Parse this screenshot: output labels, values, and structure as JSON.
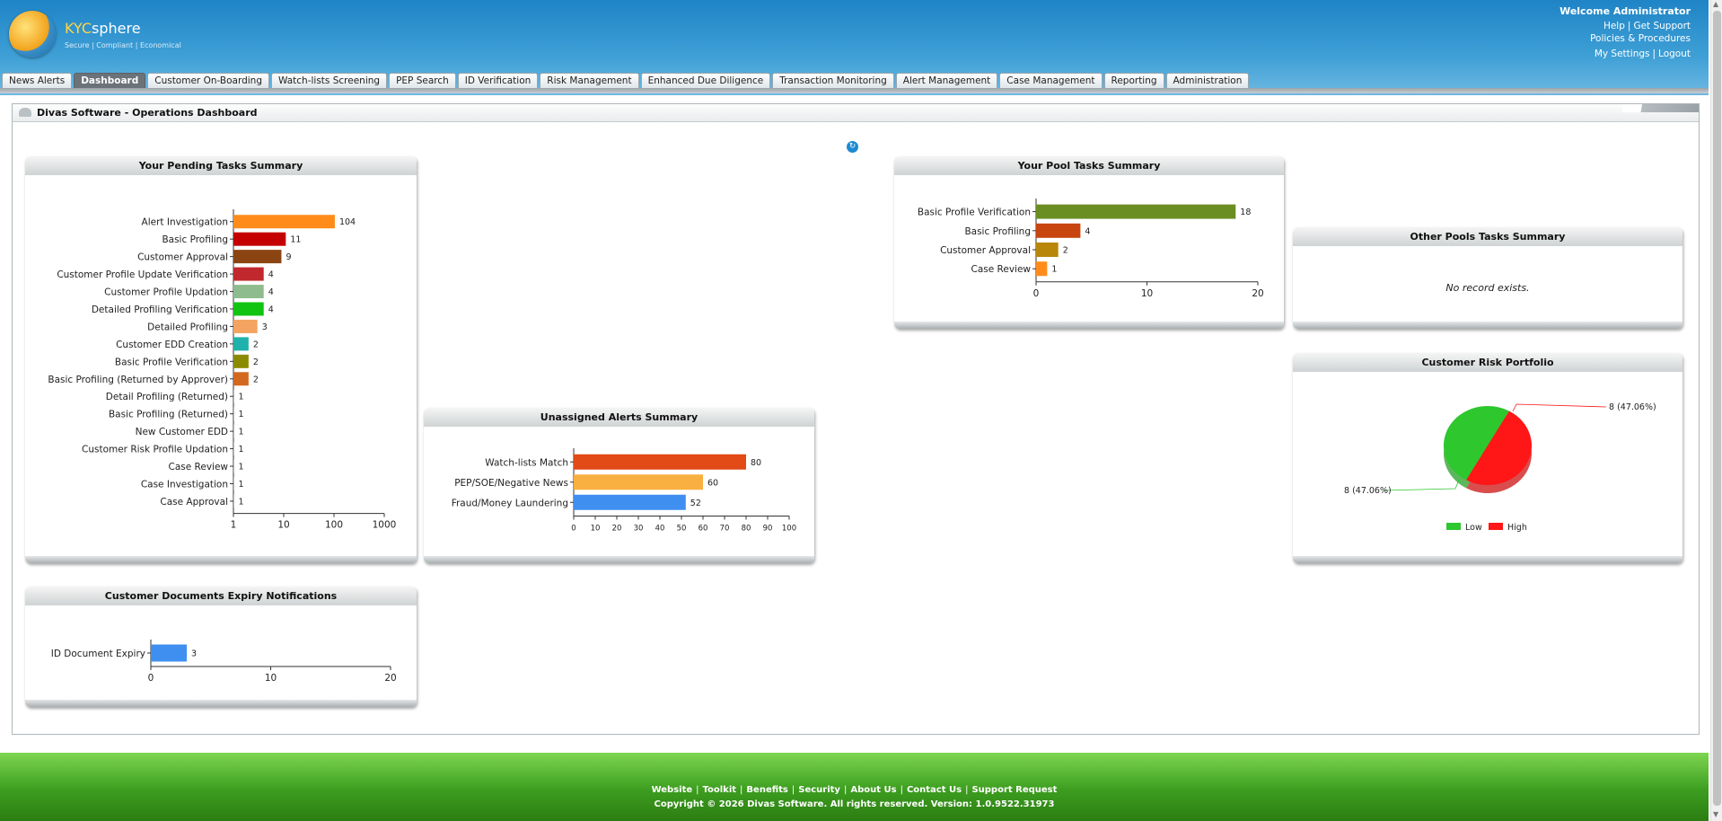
{
  "header": {
    "brand_kyc": "KYC",
    "brand_sphere": "sphere",
    "tagline": "Secure | Compliant | Economical",
    "welcome": "Welcome Administrator",
    "links_row1": [
      "Help",
      "Get Support"
    ],
    "links_row2": [
      "Policies & Procedures"
    ],
    "links_row3": [
      "My Settings",
      "Logout"
    ]
  },
  "tabs": [
    {
      "label": "News Alerts",
      "active": false
    },
    {
      "label": "Dashboard",
      "active": true
    },
    {
      "label": "Customer On-Boarding",
      "active": false
    },
    {
      "label": "Watch-lists Screening",
      "active": false
    },
    {
      "label": "PEP Search",
      "active": false
    },
    {
      "label": "ID Verification",
      "active": false
    },
    {
      "label": "Risk Management",
      "active": false
    },
    {
      "label": "Enhanced Due Diligence",
      "active": false
    },
    {
      "label": "Transaction Monitoring",
      "active": false
    },
    {
      "label": "Alert Management",
      "active": false
    },
    {
      "label": "Case Management",
      "active": false
    },
    {
      "label": "Reporting",
      "active": false
    },
    {
      "label": "Administration",
      "active": false
    }
  ],
  "panel_title": "Divas Software - Operations Dashboard",
  "widgets": {
    "pending": {
      "title": "Your Pending Tasks Summary"
    },
    "pool": {
      "title": "Your Pool Tasks Summary"
    },
    "other": {
      "title": "Other Pools Tasks Summary",
      "empty_text": "No record exists."
    },
    "unassigned": {
      "title": "Unassigned Alerts Summary"
    },
    "risk": {
      "title": "Customer Risk Portfolio"
    },
    "expiry": {
      "title": "Customer Documents Expiry Notifications"
    }
  },
  "chart_data": [
    {
      "id": "pending",
      "type": "bar",
      "orientation": "horizontal",
      "log_scale": true,
      "categories": [
        "Alert Investigation",
        "Basic Profiling",
        "Customer Approval",
        "Customer Profile Update Verification",
        "Customer Profile Updation",
        "Detailed Profiling Verification",
        "Detailed Profiling",
        "Customer EDD Creation",
        "Basic Profile Verification",
        "Basic Profiling (Returned by Approver)",
        "Detail Profiling (Returned)",
        "Basic Profiling (Returned)",
        "New Customer EDD",
        "Customer Risk Profile Updation",
        "Case Review",
        "Case Investigation",
        "Case Approval"
      ],
      "values": [
        104,
        11,
        9,
        4,
        4,
        4,
        3,
        2,
        2,
        2,
        1,
        1,
        1,
        1,
        1,
        1,
        1
      ],
      "colors": [
        "#ff8c1a",
        "#c40000",
        "#8b4513",
        "#c0282d",
        "#8fbc8f",
        "#11c411",
        "#f4a460",
        "#20b2aa",
        "#8b8b00",
        "#d2691e",
        "#777777",
        "#777777",
        "#777777",
        "#777777",
        "#777777",
        "#777777",
        "#777777"
      ],
      "xticks": [
        "1",
        "10",
        "100",
        "1000"
      ],
      "xlim": [
        1,
        1000
      ]
    },
    {
      "id": "pool",
      "type": "bar",
      "orientation": "horizontal",
      "categories": [
        "Basic Profile Verification",
        "Basic Profiling",
        "Customer Approval",
        "Case Review"
      ],
      "values": [
        18,
        4,
        2,
        1
      ],
      "colors": [
        "#6b8e23",
        "#c84510",
        "#b8860b",
        "#ff8c1a"
      ],
      "xticks": [
        "0",
        "10",
        "20"
      ],
      "xlim": [
        0,
        20
      ]
    },
    {
      "id": "unassigned",
      "type": "bar",
      "orientation": "horizontal",
      "categories": [
        "Watch-lists Match",
        "PEP/SOE/Negative News",
        "Fraud/Money Laundering"
      ],
      "values": [
        80,
        60,
        52
      ],
      "colors": [
        "#e24a16",
        "#f9b040",
        "#3f8ff0"
      ],
      "xticks": [
        "0",
        "10",
        "20",
        "30",
        "40",
        "50",
        "60",
        "70",
        "80",
        "90",
        "100"
      ],
      "xlim": [
        0,
        100
      ]
    },
    {
      "id": "risk",
      "type": "pie",
      "labels": [
        "Low",
        "High"
      ],
      "values": [
        8,
        8
      ],
      "data_labels": [
        "8 (47.06%)",
        "8 (47.06%)"
      ],
      "colors": [
        "#2ec72e",
        "#ff1616"
      ],
      "legend": "bottom"
    },
    {
      "id": "expiry",
      "type": "bar",
      "orientation": "horizontal",
      "categories": [
        "ID Document Expiry"
      ],
      "values": [
        3
      ],
      "colors": [
        "#3f8ff0"
      ],
      "xticks": [
        "0",
        "10",
        "20"
      ],
      "xlim": [
        0,
        20
      ]
    }
  ],
  "footer": {
    "links": [
      "Website",
      "Toolkit",
      "Benefits",
      "Security",
      "About Us",
      "Contact Us",
      "Support Request"
    ],
    "copyright": "Copyright © 2026 Divas Software. All rights reserved. Version: 1.0.9522.31973"
  }
}
